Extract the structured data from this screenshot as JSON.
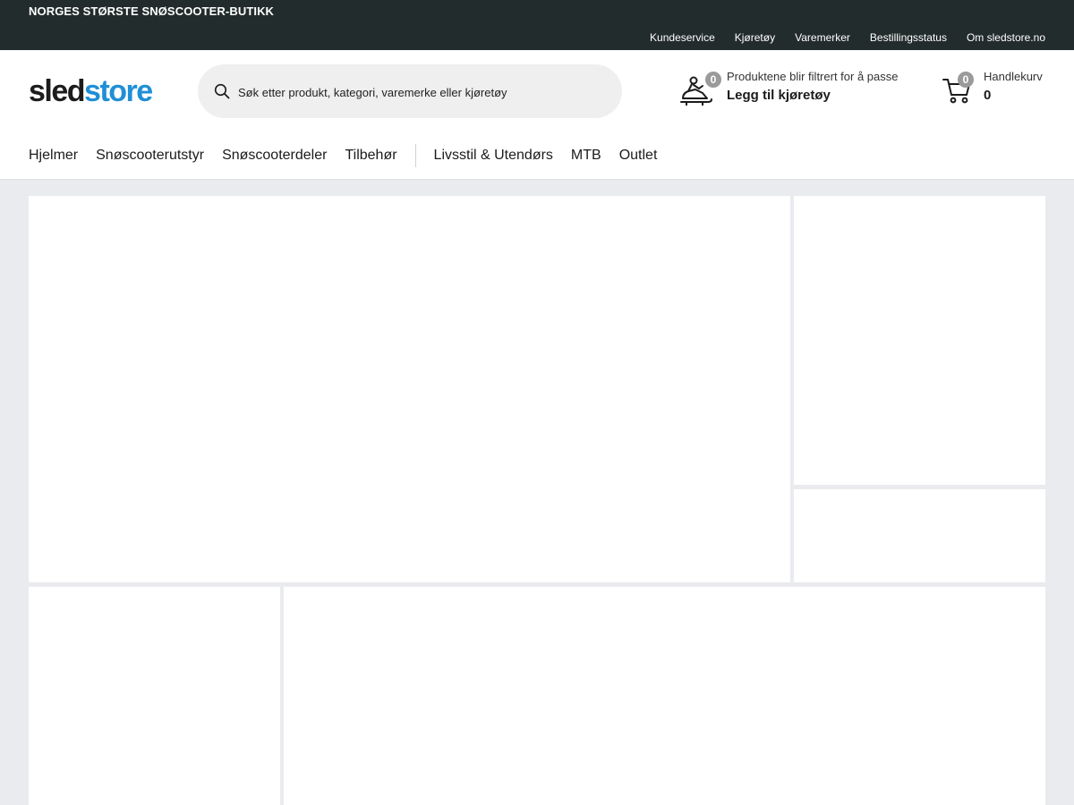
{
  "topbar": {
    "tagline": "NORGES STØRSTE SNØSCOOTER-BUTIKK",
    "links": [
      "Kundeservice",
      "Kjøretøy",
      "Varemerker",
      "Bestillingsstatus",
      "Om sledstore.no"
    ]
  },
  "logo": {
    "part1": "sled",
    "part2": "store"
  },
  "search": {
    "placeholder": "Søk etter produkt, kategori, varemerke eller kjøretøy"
  },
  "vehicle": {
    "badge": "0",
    "info": "Produktene blir filtrert for å passe",
    "action": "Legg til kjøretøy"
  },
  "cart": {
    "badge": "0",
    "label": "Handlekurv",
    "count": "0"
  },
  "nav": {
    "items": [
      "Hjelmer",
      "Snøscooterutstyr",
      "Snøscooterdeler",
      "Tilbehør"
    ],
    "items2": [
      "Livsstil & Utendørs",
      "MTB",
      "Outlet"
    ]
  },
  "colors": {
    "topbar": "#232c2c",
    "brand_blue": "#1f8fd6",
    "page_bg": "#e9ebee"
  }
}
